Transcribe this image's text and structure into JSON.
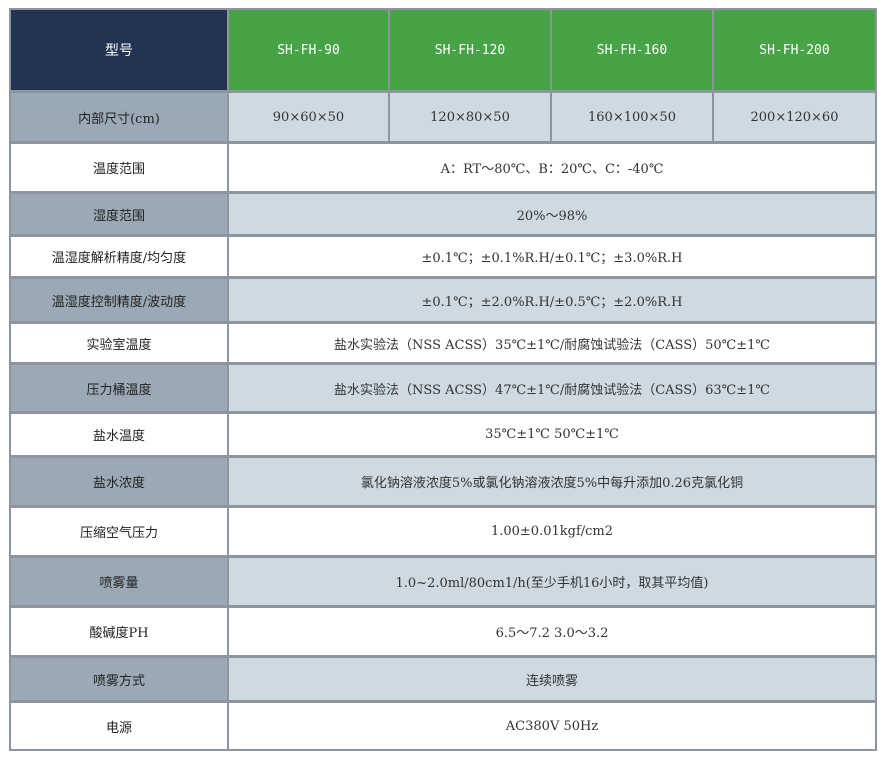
{
  "header": {
    "label": "型号",
    "models": [
      "SH-FH-90",
      "SH-FH-120",
      "SH-FH-160",
      "SH-FH-200"
    ]
  },
  "dims": {
    "label": "内部尺寸(cm)",
    "values": [
      "90×60×50",
      "120×80×50",
      "160×100×50",
      "200×120×60"
    ]
  },
  "rows": [
    {
      "label": "温度范围",
      "value": "A：RT～80℃、B：20℃、C：-40℃"
    },
    {
      "label": "湿度范围",
      "value": "20%～98%"
    },
    {
      "label": "温湿度解析精度/均匀度",
      "value": "±0.1℃；±0.1%R.H/±0.1℃；±3.0%R.H"
    },
    {
      "label": "温湿度控制精度/波动度",
      "value": "±0.1℃；±2.0%R.H/±0.5℃；±2.0%R.H"
    },
    {
      "label": "实验室温度",
      "value": "盐水实验法（NSS ACSS）35℃±1℃/耐腐蚀试验法（CASS）50℃±1℃"
    },
    {
      "label": "压力桶温度",
      "value": "盐水实验法（NSS ACSS）47℃±1℃/耐腐蚀试验法（CASS）63℃±1℃"
    },
    {
      "label": "盐水温度",
      "value": "35℃±1℃  50℃±1℃"
    },
    {
      "label": "盐水浓度",
      "value": "氯化钠溶液浓度5%或氯化钠溶液浓度5%中每升添加0.26克氯化铜"
    },
    {
      "label": "压缩空气压力",
      "value": "1.00±0.01kgf/cm2"
    },
    {
      "label": "喷雾量",
      "value": "1.0~2.0ml/80cm1/h(至少手机16小时，取其平均值)"
    },
    {
      "label": "酸碱度PH",
      "value": "6.5～7.2  3.0～3.2"
    },
    {
      "label": "喷雾方式",
      "value": "连续喷雾"
    },
    {
      "label": "电源",
      "value": "AC380V 50Hz"
    }
  ],
  "colors": {
    "header_dark": "#223452",
    "header_green": "#46a447",
    "label_dark": "#9aa9b5",
    "value_dark": "#cfd9e1",
    "border": "#8d959e"
  }
}
